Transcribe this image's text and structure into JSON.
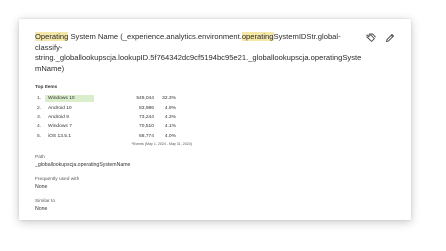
{
  "title": {
    "parts": [
      {
        "text": "Operating",
        "highlight": true
      },
      {
        "text": " System Name (_experience.analytics.environment.",
        "highlight": false
      },
      {
        "text": "operating",
        "highlight": true
      },
      {
        "text": "SystemIDStr.global-classify-string._globallookupscja.lookupID.5f764342dc9cf5194bc95e21._globallookupscja.operatingSystemName)",
        "highlight": false
      }
    ]
  },
  "actions": {
    "icons": [
      "tags-icon",
      "edit-pencil-icon"
    ]
  },
  "top_items": {
    "label": "Top Items",
    "rows": [
      {
        "index": "1.",
        "name": "Windows 10",
        "value": "549,044",
        "percent": "32.3%",
        "share": 1.0
      },
      {
        "index": "2.",
        "name": "Android 10",
        "value": "83,986",
        "percent": "4.9%",
        "share": 0.0
      },
      {
        "index": "3.",
        "name": "Android 9",
        "value": "73,244",
        "percent": "4.3%",
        "share": 0.0
      },
      {
        "index": "4.",
        "name": "Windows 7",
        "value": "70,510",
        "percent": "4.1%",
        "share": 0.0
      },
      {
        "index": "5.",
        "name": "iOS 13.5.1",
        "value": "68,774",
        "percent": "4.0%",
        "share": 0.0
      }
    ],
    "footnote": "*Events (May 1, 2024 - May 31, 2024)"
  },
  "path": {
    "label": "Path",
    "value": "_globallookupscja.operatingSystemName"
  },
  "frequently_used_with": {
    "label": "Frequently used with",
    "value": "None"
  },
  "similar_to": {
    "label": "Similar to",
    "value": "None"
  },
  "colors": {
    "highlight": "#f4e7a8",
    "bar": "#dbeecb"
  }
}
